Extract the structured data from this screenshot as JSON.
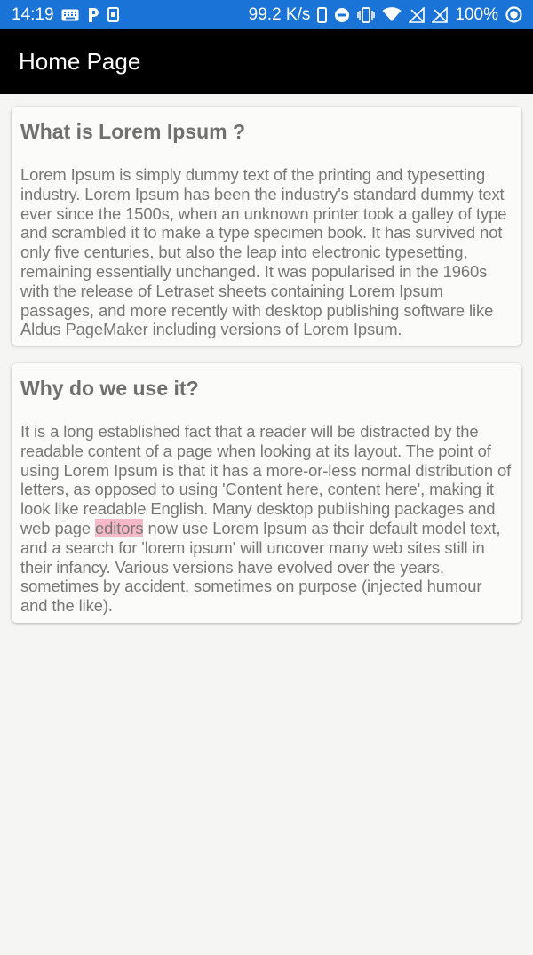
{
  "status_bar": {
    "time": "14:19",
    "net_speed": "99.2 K/s",
    "battery": "100%",
    "left_icons": [
      "keyboard-icon",
      "p-app-icon",
      "sim-icon"
    ],
    "right_icons": [
      "phone-icon",
      "dnd-icon",
      "vibrate-icon",
      "wifi-icon",
      "no-signal-icon",
      "no-signal-icon",
      "battery-circle-icon"
    ]
  },
  "app_bar": {
    "title": "Home Page"
  },
  "cards": [
    {
      "title": "What is Lorem Ipsum ?",
      "body": " Lorem Ipsum is simply dummy text of the printing and typesetting industry. Lorem Ipsum has been the industry's standard dummy text ever since the 1500s, when an unknown printer took a galley of type and scrambled it to make a type specimen book. It has survived not only five centuries, but also the leap into electronic typesetting, remaining essentially unchanged. It was popularised in the 1960s with the release of Letraset sheets containing Lorem Ipsum passages, and more recently with desktop publishing software like Aldus PageMaker including versions of Lorem Ipsum."
    },
    {
      "title": "Why do we use it?",
      "body_before": " It is a long established fact that a reader will be distracted by the readable content of a page when looking at its layout. The point of using Lorem Ipsum is that it has a more-or-less normal distribution of letters, as opposed to using 'Content here, content here', making it look like readable English. Many desktop publishing packages and web page ",
      "body_highlight": "editors",
      "body_after": " now use Lorem Ipsum as their default model text, and a search for 'lorem ipsum' will uncover many web sites still in their infancy. Various versions have evolved over the years, sometimes by accident, sometimes on purpose (injected humour and the like)."
    }
  ],
  "colors": {
    "status_bar": "#1a73d6",
    "app_bar": "#000000",
    "background": "#f5f5f4",
    "card": "#fbfbfa",
    "title_text": "#707070",
    "body_text": "#777777",
    "highlight": "#f7b8c8"
  }
}
